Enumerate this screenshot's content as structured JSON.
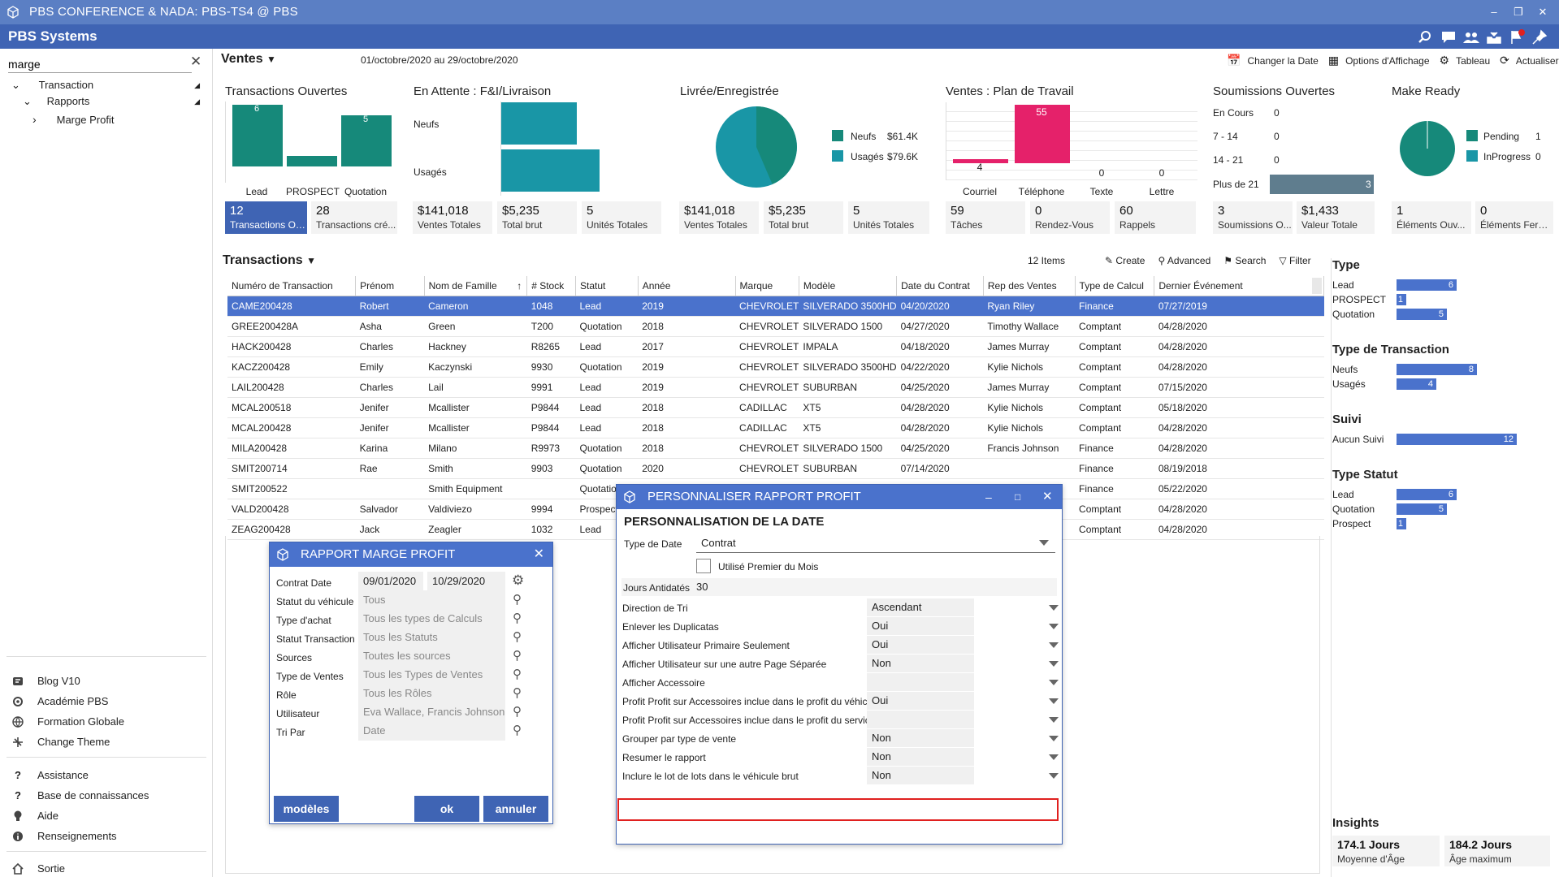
{
  "window": {
    "title": "PBS CONFERENCE & NADA: PBS-TS4 @ PBS",
    "brand": "PBS Systems"
  },
  "sidebar": {
    "search_value": "marge",
    "tree": [
      {
        "label": "Transaction"
      },
      {
        "label": "Rapports"
      },
      {
        "label": "Marge Profit"
      }
    ],
    "links": [
      {
        "label": "Blog V10",
        "icon": "blog-icon"
      },
      {
        "label": "Académie PBS",
        "icon": "academy-icon"
      },
      {
        "label": "Formation Globale",
        "icon": "globe-icon"
      },
      {
        "label": "Change Theme",
        "icon": "theme-icon"
      }
    ],
    "help_links": [
      {
        "label": "Assistance",
        "icon": "question-icon"
      },
      {
        "label": "Base de connaissances",
        "icon": "question-icon"
      },
      {
        "label": "Aide",
        "icon": "bulb-icon"
      },
      {
        "label": "Renseignements",
        "icon": "info-icon"
      }
    ],
    "exit": "Sortie"
  },
  "header": {
    "view_label": "Ventes",
    "date_range": "01/octobre/2020 au 29/octobre/2020",
    "actions": [
      "Changer la Date",
      "Options d'Affichage",
      "Tableau",
      "Actualiser"
    ]
  },
  "cards": {
    "open": {
      "title": "Transactions Ouvertes",
      "bars": [
        {
          "label": "Lead",
          "value": 6
        },
        {
          "label": "PROSPECT",
          "value": 1
        },
        {
          "label": "Quotation",
          "value": 5
        }
      ],
      "stats": [
        {
          "value": "12",
          "label": "Transactions Ou..."
        },
        {
          "value": "28",
          "label": "Transactions cré..."
        }
      ]
    },
    "pending": {
      "title": "En Attente : F&I/Livraison",
      "bars": [
        {
          "label": "Neufs",
          "value": "$61.4K",
          "amount": 61.4
        },
        {
          "label": "Usagés",
          "value": "$79.6K",
          "amount": 79.6
        }
      ],
      "stats": [
        {
          "value": "$141,018",
          "label": "Ventes Totales"
        },
        {
          "value": "$5,235",
          "label": "Total brut"
        },
        {
          "value": "5",
          "label": "Unités Totales"
        }
      ]
    },
    "delivered": {
      "title": "Livrée/Enregistrée",
      "legend": [
        {
          "label": "Neufs",
          "value": "$61.4K",
          "color": "#16897a"
        },
        {
          "label": "Usagés",
          "value": "$79.6K",
          "color": "#1996a6"
        }
      ],
      "stats": [
        {
          "value": "$141,018",
          "label": "Ventes Totales"
        },
        {
          "value": "$5,235",
          "label": "Total brut"
        },
        {
          "value": "5",
          "label": "Unités Totales"
        }
      ]
    },
    "plan": {
      "title": "Ventes : Plan de Travail",
      "bars": [
        {
          "label": "Courriel",
          "value": 4
        },
        {
          "label": "Téléphone",
          "value": 55
        },
        {
          "label": "Texte",
          "value": 0
        },
        {
          "label": "Lettre",
          "value": 0
        }
      ],
      "stats": [
        {
          "value": "59",
          "label": "Tâches"
        },
        {
          "value": "0",
          "label": "Rendez-Vous"
        },
        {
          "value": "60",
          "label": "Rappels"
        }
      ]
    },
    "quotes": {
      "title": "Soumissions Ouvertes",
      "rows": [
        {
          "label": "En Cours",
          "value": "0"
        },
        {
          "label": "7 - 14",
          "value": "0"
        },
        {
          "label": "14 - 21",
          "value": "0"
        },
        {
          "label": "Plus de 21",
          "value": "3"
        }
      ],
      "stats": [
        {
          "value": "3",
          "label": "Soumissions O..."
        },
        {
          "value": "$1,433",
          "label": "Valeur Totale"
        }
      ]
    },
    "ready": {
      "title": "Make Ready",
      "legend": [
        {
          "label": "Pending",
          "value": "1",
          "color": "#16897a"
        },
        {
          "label": "InProgress",
          "value": "0",
          "color": "#1996a6"
        }
      ],
      "stats": [
        {
          "value": "1",
          "label": "Éléments Ouv..."
        },
        {
          "value": "0",
          "label": "Éléments Ferm..."
        }
      ]
    }
  },
  "transactions": {
    "title": "Transactions",
    "count": "12 Items",
    "tools": [
      "Create",
      "Advanced",
      "Search",
      "Filter"
    ],
    "columns": [
      "Numéro de Transaction",
      "Prénom",
      "Nom de Famille",
      "# Stock",
      "Statut",
      "Année",
      "Marque",
      "Modèle",
      "Date du Contrat",
      "Rep des Ventes",
      "Type de Calcul",
      "Dernier Événement"
    ],
    "rows": [
      [
        "CAME200428",
        "Robert",
        "Cameron",
        "1048",
        "Lead",
        "2019",
        "CHEVROLET",
        "SILVERADO 3500HD",
        "04/20/2020",
        "Ryan Riley",
        "Finance",
        "07/27/2019"
      ],
      [
        "GREE200428A",
        "Asha",
        "Green",
        "T200",
        "Quotation",
        "2018",
        "CHEVROLET",
        "SILVERADO 1500",
        "04/27/2020",
        "Timothy Wallace",
        "Comptant",
        "04/28/2020"
      ],
      [
        "HACK200428",
        "Charles",
        "Hackney",
        "R8265",
        "Lead",
        "2017",
        "CHEVROLET",
        "IMPALA",
        "04/18/2020",
        "James Murray",
        "Comptant",
        "04/28/2020"
      ],
      [
        "KACZ200428",
        "Emily",
        "Kaczynski",
        "9930",
        "Quotation",
        "2019",
        "CHEVROLET",
        "SILVERADO 3500HD",
        "04/22/2020",
        "Kylie Nichols",
        "Comptant",
        "04/28/2020"
      ],
      [
        "LAIL200428",
        "Charles",
        "Lail",
        "9991",
        "Lead",
        "2019",
        "CHEVROLET",
        "SUBURBAN",
        "04/25/2020",
        "James Murray",
        "Comptant",
        "07/15/2020"
      ],
      [
        "MCAL200518",
        "Jenifer",
        "Mcallister",
        "P9844",
        "Lead",
        "2018",
        "CADILLAC",
        "XT5",
        "04/28/2020",
        "Kylie Nichols",
        "Comptant",
        "05/18/2020"
      ],
      [
        "MCAL200428",
        "Jenifer",
        "Mcallister",
        "P9844",
        "Lead",
        "2018",
        "CADILLAC",
        "XT5",
        "04/28/2020",
        "Kylie Nichols",
        "Comptant",
        "04/28/2020"
      ],
      [
        "MILA200428",
        "Karina",
        "Milano",
        "R9973",
        "Quotation",
        "2018",
        "CHEVROLET",
        "SILVERADO 1500",
        "04/25/2020",
        "Francis Johnson",
        "Finance",
        "04/28/2020"
      ],
      [
        "SMIT200714",
        "Rae",
        "Smith",
        "9903",
        "Quotation",
        "2020",
        "CHEVROLET",
        "SUBURBAN",
        "07/14/2020",
        "",
        "Finance",
        "08/19/2018"
      ],
      [
        "SMIT200522",
        "",
        "Smith Equipment",
        "",
        "Quotation",
        "",
        "",
        "",
        "",
        "",
        "Finance",
        "05/22/2020"
      ],
      [
        "VALD200428",
        "Salvador",
        "Valdiviezo",
        "9994",
        "Prospect",
        "",
        "",
        "",
        "",
        "",
        "Comptant",
        "04/28/2020"
      ],
      [
        "ZEAG200428",
        "Jack",
        "Zeagler",
        "1032",
        "Lead",
        "",
        "",
        "",
        "",
        "",
        "Comptant",
        "04/28/2020"
      ]
    ]
  },
  "right_panel": {
    "groups": [
      {
        "title": "Type",
        "items": [
          {
            "label": "Lead",
            "value": 6
          },
          {
            "label": "PROSPECT",
            "value": 1
          },
          {
            "label": "Quotation",
            "value": 5
          }
        ]
      },
      {
        "title": "Type de Transaction",
        "items": [
          {
            "label": "Neufs",
            "value": 8
          },
          {
            "label": "Usagés",
            "value": 4
          }
        ]
      },
      {
        "title": "Suivi",
        "items": [
          {
            "label": "Aucun Suivi",
            "value": 12
          }
        ]
      },
      {
        "title": "Type Statut",
        "items": [
          {
            "label": "Lead",
            "value": 6
          },
          {
            "label": "Quotation",
            "value": 5
          },
          {
            "label": "Prospect",
            "value": 1
          }
        ]
      }
    ],
    "insights_title": "Insights",
    "insights": [
      {
        "value": "174.1 Jours",
        "label": "Moyenne d'Âge"
      },
      {
        "value": "184.2 Jours",
        "label": "Âge maximum"
      }
    ]
  },
  "dialog_report": {
    "title": "RAPPORT MARGE PROFIT",
    "contract_label": "Contrat Date",
    "date_from": "09/01/2020",
    "date_to": "10/29/2020",
    "fields": [
      {
        "label": "Statut du véhicule",
        "value": "Tous"
      },
      {
        "label": "Type d'achat",
        "value": "Tous les types de Calculs"
      },
      {
        "label": "Statut Transaction",
        "value": "Tous les Statuts"
      },
      {
        "label": "Sources",
        "value": "Toutes les sources"
      },
      {
        "label": "Type de Ventes",
        "value": "Tous les Types de Ventes"
      },
      {
        "label": "Rôle",
        "value": "Tous les Rôles"
      },
      {
        "label": "Utilisateur",
        "value": "Eva  Wallace, Francis  Johnson, Gar"
      },
      {
        "label": "Tri Par",
        "value": "Date"
      }
    ],
    "btn_models": "modèles",
    "btn_ok": "ok",
    "btn_cancel": "annuler"
  },
  "dialog_custom": {
    "title": "PERSONNALISER RAPPORT PROFIT",
    "section": "PERSONNALISATION DE LA DATE",
    "date_type_label": "Type de Date",
    "date_type_value": "Contrat",
    "checkbox_label": "Utilisé Premier du Mois",
    "backdate_label": "Jours Antidatés",
    "backdate_value": "30",
    "rows": [
      {
        "label": "Direction de Tri",
        "value": "Ascendant"
      },
      {
        "label": "Enlever les Duplicatas",
        "value": "Oui"
      },
      {
        "label": "Afficher Utilisateur Primaire Seulement",
        "value": "Oui"
      },
      {
        "label": "Afficher Utilisateur sur une autre Page Séparée",
        "value": "Non"
      },
      {
        "label": "Afficher Accessoire",
        "value": ""
      },
      {
        "label": "Profit Profit sur Accessoires inclue dans le profit du véhicule",
        "value": "Oui"
      },
      {
        "label": "Profit Profit sur Accessoires inclue dans le profit du services financier",
        "value": ""
      },
      {
        "label": "Grouper par type de vente",
        "value": "Non"
      },
      {
        "label": "Resumer le rapport",
        "value": "Non"
      },
      {
        "label": "Inclure le lot de lots dans le véhicule brut",
        "value": "Non"
      }
    ],
    "highlight_color": "#e0201f"
  }
}
